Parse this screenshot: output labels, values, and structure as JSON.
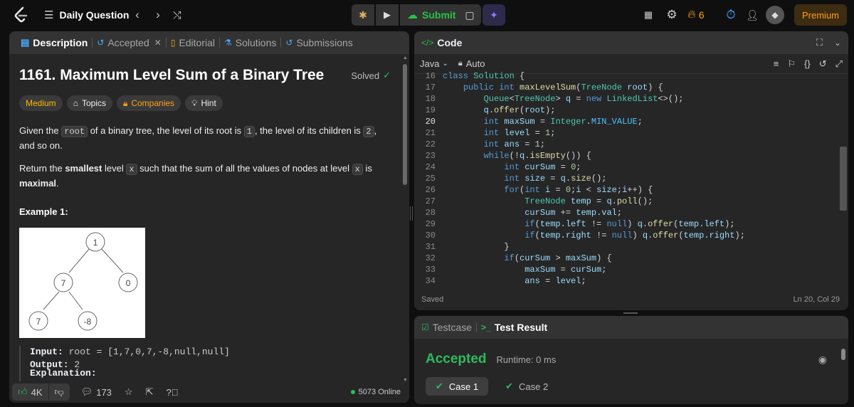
{
  "topbar": {
    "title": "Daily Question",
    "submit": "Submit",
    "streak": "6",
    "premium": "Premium"
  },
  "desc": {
    "tabs": {
      "description": "Description",
      "accepted": "Accepted",
      "editorial": "Editorial",
      "solutions": "Solutions",
      "submissions": "Submissions"
    },
    "title": "1161. Maximum Level Sum of a Binary Tree",
    "solved": "Solved",
    "chips": {
      "difficulty": "Medium",
      "topics": "Topics",
      "companies": "Companies",
      "hint": "Hint"
    },
    "p1a": "Given the ",
    "p1code": "root",
    "p1b": " of a binary tree, the level of its root is ",
    "p1one": "1",
    "p1c": ", the level of its children is ",
    "p1two": "2",
    "p1d": ", and so on.",
    "p2a": "Return the ",
    "p2b": "smallest",
    "p2c": " level ",
    "p2x": "x",
    "p2d": " such that the sum of all the values of nodes at level ",
    "p2e": " is ",
    "p2f": "maximal",
    "p2g": ".",
    "example_title": "Example 1:",
    "tree": {
      "n1": "1",
      "n2": "7",
      "n3": "0",
      "n4": "7",
      "n5": "-8"
    },
    "input_label": "Input:",
    "input_value": " root = [1,7,0,7,-8,null,null]",
    "output_label": "Output:",
    "output_value": " 2",
    "explanation_cut": "Explanation:",
    "footer": {
      "likes": "4K",
      "comments": "173",
      "online": "5073 Online"
    }
  },
  "code": {
    "title": "Code",
    "language": "Java",
    "auto": "Auto",
    "saved": "Saved",
    "cursor": "Ln 20, Col 29",
    "lines": [
      {
        "n": "16"
      },
      {
        "n": "17"
      },
      {
        "n": "18"
      },
      {
        "n": "19"
      },
      {
        "n": "20"
      },
      {
        "n": "21"
      },
      {
        "n": "22"
      },
      {
        "n": "23"
      },
      {
        "n": "24"
      },
      {
        "n": "25"
      },
      {
        "n": "26"
      },
      {
        "n": "27"
      },
      {
        "n": "28"
      },
      {
        "n": "29"
      },
      {
        "n": "30"
      },
      {
        "n": "31"
      },
      {
        "n": "32"
      },
      {
        "n": "33"
      },
      {
        "n": "34"
      }
    ]
  },
  "result": {
    "tab_testcase": "Testcase",
    "tab_result": "Test Result",
    "status": "Accepted",
    "runtime": "Runtime: 0 ms",
    "case1": "Case 1",
    "case2": "Case 2"
  },
  "colors": {
    "accent": "#ffa116",
    "green": "#2cbb5d",
    "submit": "#28c244"
  }
}
